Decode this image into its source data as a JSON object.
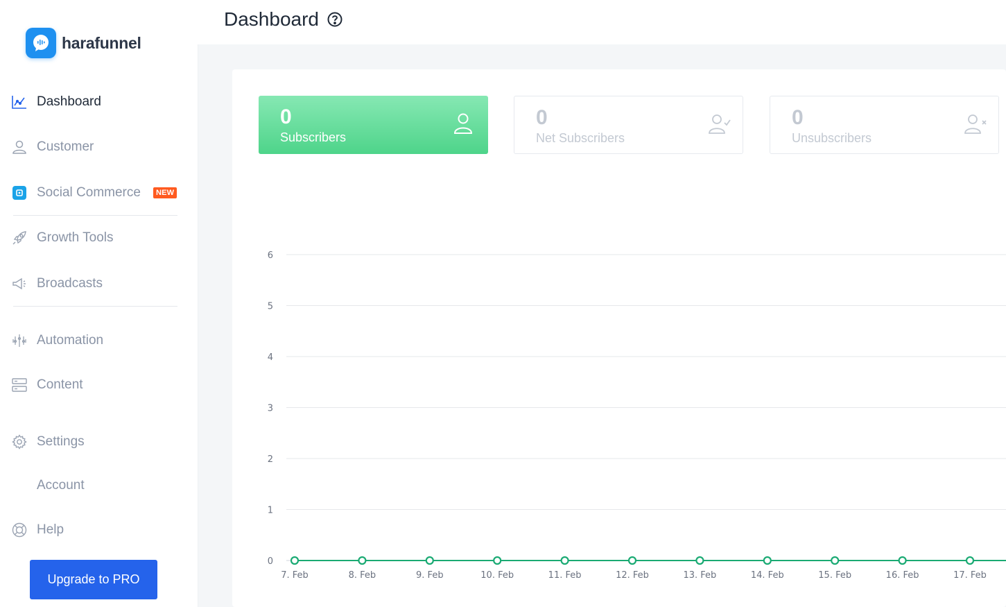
{
  "app": {
    "name": "harafunnel"
  },
  "header": {
    "title": "Dashboard"
  },
  "sidebar": {
    "items": [
      {
        "label": "Dashboard",
        "icon": "chart-line-icon"
      },
      {
        "label": "Customer",
        "icon": "user-icon"
      },
      {
        "label": "Social Commerce",
        "icon": "social-commerce-icon",
        "badge": "NEW"
      },
      {
        "label": "Growth Tools",
        "icon": "rocket-icon"
      },
      {
        "label": "Broadcasts",
        "icon": "megaphone-icon"
      },
      {
        "label": "Automation",
        "icon": "automation-icon"
      },
      {
        "label": "Content",
        "icon": "content-icon"
      },
      {
        "label": "Settings",
        "icon": "gear-icon"
      },
      {
        "label": "Account"
      },
      {
        "label": "Help",
        "icon": "lifebuoy-icon"
      }
    ],
    "upgrade_label": "Upgrade to PRO"
  },
  "stats": [
    {
      "value": "0",
      "label": "Subscribers",
      "icon": "user-icon"
    },
    {
      "value": "0",
      "label": "Net Subscribers",
      "icon": "user-check-icon"
    },
    {
      "value": "0",
      "label": "Unsubscribers",
      "icon": "user-x-icon"
    }
  ],
  "colors": {
    "accent": "#2563eb",
    "green": "#4ed48a",
    "series": "#1aaa73",
    "badge": "#ff5a1f"
  },
  "chart_data": {
    "type": "line",
    "x": [
      "7. Feb",
      "8. Feb",
      "9. Feb",
      "10. Feb",
      "11. Feb",
      "12. Feb",
      "13. Feb",
      "14. Feb",
      "15. Feb",
      "16. Feb",
      "17. Feb"
    ],
    "series": [
      {
        "values": [
          0,
          0,
          0,
          0,
          0,
          0,
          0,
          0,
          0,
          0,
          0
        ]
      }
    ],
    "ylim": [
      0,
      6
    ],
    "yticks": [
      "0",
      "1",
      "2",
      "3",
      "4",
      "5",
      "6"
    ],
    "grid": true
  }
}
